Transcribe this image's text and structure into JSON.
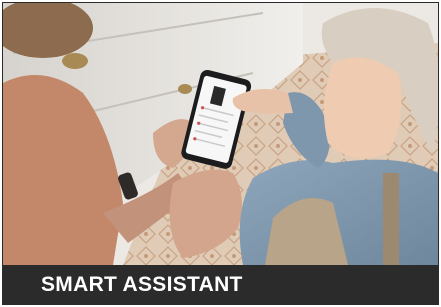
{
  "caption": {
    "title": "SMART ASSISTANT"
  },
  "colors": {
    "caption_bar": "#2b2b2b",
    "caption_text": "#ffffff",
    "cabinet": "#e9e7e3",
    "floor_tile": "#d9bfa8",
    "shirt": "#7f97ad",
    "hair": "#d8cfc2"
  },
  "photo": {
    "subject": "adult-and-child-using-smartphone"
  }
}
